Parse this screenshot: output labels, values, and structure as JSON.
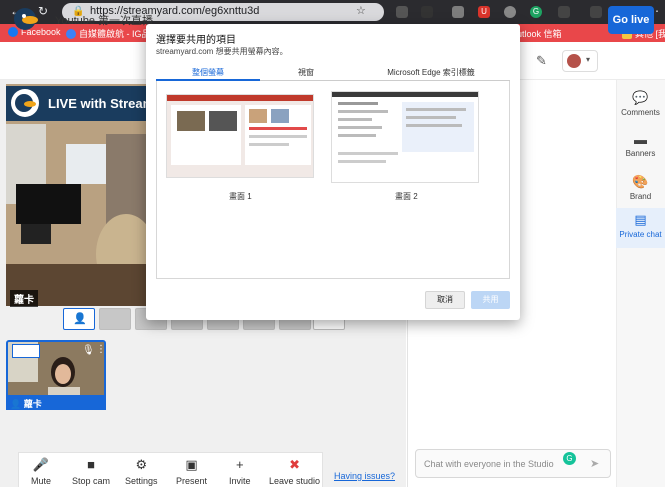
{
  "browser": {
    "url": "https://streamyard.com/eg6xnttu3d",
    "bookmarks": [
      {
        "label": "Facebook"
      },
      {
        "label": "自媒體啟航 - IG品..."
      },
      {
        "label": "Outlook 信箱"
      },
      {
        "label": "其他 [我的..."
      }
    ]
  },
  "header": {
    "broadcast_title": "Youtube 第一次直播",
    "go_live_label": "Go live"
  },
  "stage": {
    "live_banner_text": "LIVE with Stream",
    "main_participant_name": "蘿卡",
    "cam_participant_name": "蘿卡"
  },
  "toolbar": {
    "mute": "Mute",
    "stop_cam": "Stop cam",
    "settings": "Settings",
    "present": "Present",
    "invite": "Invite",
    "leave": "Leave studio",
    "having_issues": "Having issues?"
  },
  "chat": {
    "placeholder": "Chat with everyone in the Studio"
  },
  "rail": {
    "comments": "Comments",
    "banners": "Banners",
    "brand": "Brand",
    "private_chat": "Private chat"
  },
  "dialog": {
    "title": "選擇要共用的項目",
    "subtitle": "streamyard.com 想要共用螢幕內容。",
    "tabs": [
      "整個螢幕",
      "視窗",
      "Microsoft Edge 索引標籤"
    ],
    "screens": [
      "畫面 1",
      "畫面 2"
    ],
    "cancel_label": "取消",
    "share_label": "共用"
  },
  "colors": {
    "accent": "#1767d8",
    "bookmark_bar": "#e9474a",
    "chrome_bar": "#2b2b2f"
  }
}
